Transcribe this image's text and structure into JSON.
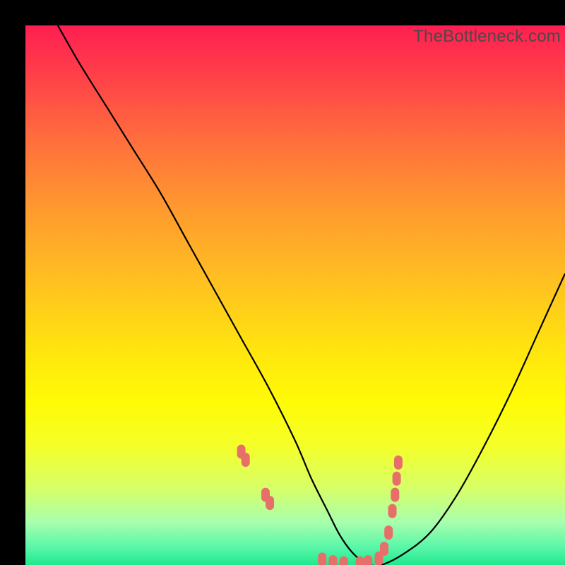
{
  "watermark": "TheBottleneck.com",
  "chart_data": {
    "type": "line",
    "title": "",
    "xlabel": "",
    "ylabel": "",
    "xlim": [
      0,
      100
    ],
    "ylim": [
      0,
      100
    ],
    "grid": false,
    "legend": false,
    "series": [
      {
        "name": "bottleneck-curve",
        "x": [
          6,
          10,
          15,
          20,
          25,
          30,
          35,
          40,
          45,
          50,
          53,
          56,
          58,
          60,
          62,
          64,
          66,
          70,
          75,
          80,
          85,
          90,
          95,
          100
        ],
        "y": [
          100,
          93,
          85,
          77,
          69,
          60,
          51,
          42,
          33,
          23,
          16,
          10,
          6,
          3,
          1,
          0,
          0,
          2,
          6,
          13,
          22,
          32,
          43,
          54
        ]
      }
    ],
    "markers": {
      "name": "highlight-points",
      "color": "#e76f6a",
      "x": [
        40,
        40.8,
        44.5,
        45.3,
        55,
        57,
        59,
        62,
        63.5,
        65.5,
        66.5,
        67.3,
        68,
        68.5,
        68.8,
        69.1
      ],
      "y": [
        21,
        19.5,
        13,
        11.5,
        1,
        0.5,
        0.3,
        0.3,
        0.5,
        1.2,
        3,
        6,
        10,
        13,
        16,
        19
      ]
    },
    "colors": {
      "curve": "#000000",
      "marker": "#e76f6a",
      "gradient_top": "#ff1e52",
      "gradient_mid": "#ffe40f",
      "gradient_bottom": "#1fe88d"
    }
  }
}
